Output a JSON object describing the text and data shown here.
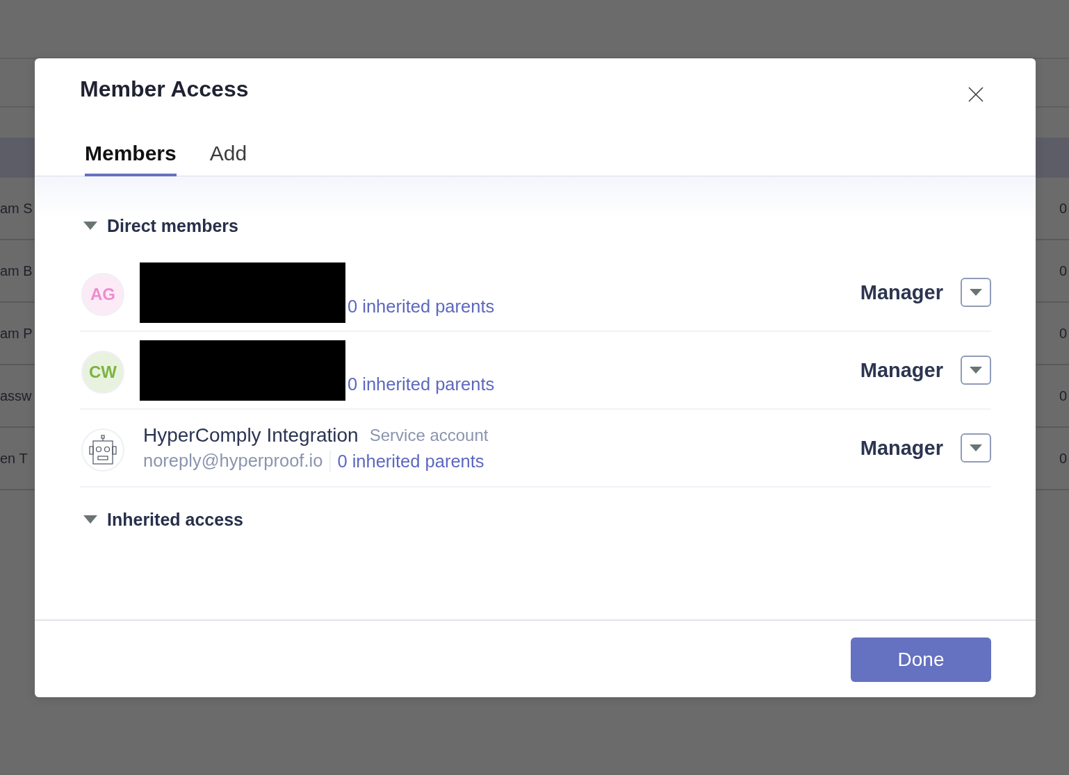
{
  "background_table": {
    "rows": [
      {
        "column_1": "am S",
        "column_2": "0"
      },
      {
        "column_1": "am B",
        "column_2": "0"
      },
      {
        "column_1": "am P",
        "column_2": "0"
      },
      {
        "column_1": "assw",
        "column_2": "0"
      },
      {
        "column_1": "en T",
        "column_2": "0"
      }
    ]
  },
  "dialog": {
    "title": "Member Access",
    "tabs": [
      {
        "label": "Members",
        "selected": true
      },
      {
        "label": "Add",
        "selected": false
      }
    ],
    "sections": [
      {
        "title": "Direct members",
        "expanded": true,
        "members": [
          {
            "kind": "person",
            "initials": "AG",
            "color": "#ef8bcf",
            "redacted": true,
            "inherited_parents": "0 inherited parents",
            "role": "Manager"
          },
          {
            "kind": "person",
            "initials": "CW",
            "color": "#7cb342",
            "redacted": true,
            "inherited_parents": "0 inherited parents",
            "role": "Manager"
          },
          {
            "kind": "service",
            "name": "HyperComply Integration",
            "account_type": "Service account",
            "email": "noreply@hyperproof.io",
            "inherited_parents": "0 inherited parents",
            "role": "Manager"
          }
        ]
      },
      {
        "title": "Inherited access",
        "expanded": true
      }
    ],
    "done_button": "Done"
  }
}
